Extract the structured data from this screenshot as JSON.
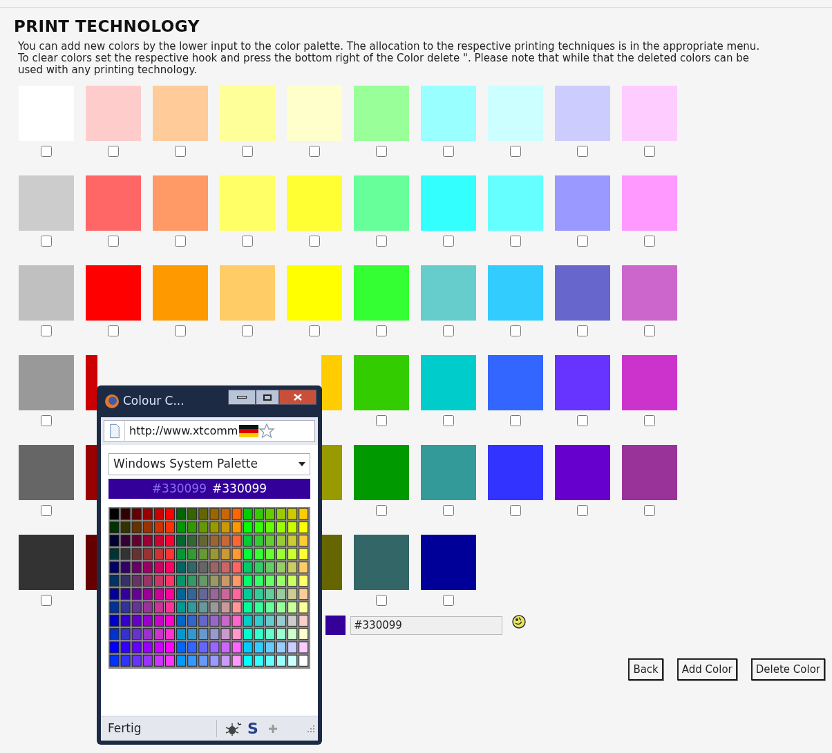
{
  "title": "PRINT TECHNOLOGY",
  "intro": [
    "You can add new colors by the lower input to the color palette. The allocation to the respective printing techniques is in the appropriate menu.",
    "To clear colors set the respective hook and press the bottom right of the Color delete \". Please note that while that the deleted colors can be used with any printing technology."
  ],
  "palette_rows": [
    [
      {
        "kind": "swatch",
        "color": "#ffffff",
        "checked": false
      },
      {
        "kind": "swatch",
        "color": "#ffcccc",
        "checked": false
      },
      {
        "kind": "swatch",
        "color": "#ffcc99",
        "checked": false
      },
      {
        "kind": "swatch",
        "color": "#ffff99",
        "checked": false
      },
      {
        "kind": "swatch",
        "color": "#ffffcc",
        "checked": false
      },
      {
        "kind": "swatch",
        "color": "#99ff99",
        "checked": false
      },
      {
        "kind": "swatch",
        "color": "#99ffff",
        "checked": false
      },
      {
        "kind": "swatch",
        "color": "#ccffff",
        "checked": false
      },
      {
        "kind": "swatch",
        "color": "#ccccff",
        "checked": false
      },
      {
        "kind": "swatch",
        "color": "#ffccff",
        "checked": false
      }
    ],
    [
      {
        "kind": "swatch",
        "color": "#cccccc",
        "checked": false
      },
      {
        "kind": "swatch",
        "color": "#ff6666",
        "checked": false
      },
      {
        "kind": "swatch",
        "color": "#ff9966",
        "checked": false
      },
      {
        "kind": "swatch",
        "color": "#ffff66",
        "checked": false
      },
      {
        "kind": "swatch",
        "color": "#ffff33",
        "checked": false
      },
      {
        "kind": "swatch",
        "color": "#66ff99",
        "checked": false
      },
      {
        "kind": "swatch",
        "color": "#33ffff",
        "checked": false
      },
      {
        "kind": "swatch",
        "color": "#66ffff",
        "checked": false
      },
      {
        "kind": "swatch",
        "color": "#9999ff",
        "checked": false
      },
      {
        "kind": "swatch",
        "color": "#ff99ff",
        "checked": false
      }
    ],
    [
      {
        "kind": "swatch",
        "color": "#c0c0c0",
        "checked": false
      },
      {
        "kind": "swatch",
        "color": "#ff0000",
        "checked": false
      },
      {
        "kind": "swatch",
        "color": "#ff9900",
        "checked": false
      },
      {
        "kind": "swatch",
        "color": "#ffcc66",
        "checked": false
      },
      {
        "kind": "swatch",
        "color": "#ffff00",
        "checked": false
      },
      {
        "kind": "swatch",
        "color": "#33ff33",
        "checked": false
      },
      {
        "kind": "swatch",
        "color": "#66cccc",
        "checked": false
      },
      {
        "kind": "swatch",
        "color": "#33ccff",
        "checked": false
      },
      {
        "kind": "swatch",
        "color": "#6666cc",
        "checked": false
      },
      {
        "kind": "swatch",
        "color": "#cc66cc",
        "checked": false
      }
    ],
    [
      {
        "kind": "swatch",
        "color": "#999999",
        "checked": false
      },
      {
        "kind": "partial",
        "color": "#cc0000"
      },
      {
        "kind": "covered"
      },
      {
        "kind": "covered"
      },
      {
        "kind": "partial",
        "color": "#ffcc00"
      },
      {
        "kind": "swatch",
        "color": "#33cc00",
        "checked": false
      },
      {
        "kind": "swatch",
        "color": "#00cccc",
        "checked": false
      },
      {
        "kind": "swatch",
        "color": "#3366ff",
        "checked": false
      },
      {
        "kind": "swatch",
        "color": "#6633ff",
        "checked": false
      },
      {
        "kind": "swatch",
        "color": "#cc33cc",
        "checked": false
      }
    ],
    [
      {
        "kind": "swatch",
        "color": "#666666",
        "checked": false
      },
      {
        "kind": "partial",
        "color": "#990000"
      },
      {
        "kind": "covered"
      },
      {
        "kind": "covered"
      },
      {
        "kind": "partial",
        "color": "#999900"
      },
      {
        "kind": "swatch",
        "color": "#009900",
        "checked": false
      },
      {
        "kind": "swatch",
        "color": "#339999",
        "checked": false
      },
      {
        "kind": "swatch",
        "color": "#3333ff",
        "checked": false
      },
      {
        "kind": "swatch",
        "color": "#6600cc",
        "checked": false
      },
      {
        "kind": "swatch",
        "color": "#993399",
        "checked": false
      }
    ],
    [
      {
        "kind": "swatch",
        "color": "#333333",
        "checked": false
      },
      {
        "kind": "partial",
        "color": "#660000"
      },
      {
        "kind": "covered"
      },
      {
        "kind": "covered"
      },
      {
        "kind": "partial",
        "color": "#666600"
      },
      {
        "kind": "swatch",
        "color": "#336666",
        "checked": false
      },
      {
        "kind": "swatch",
        "color": "#000099",
        "checked": false
      }
    ]
  ],
  "new_color": {
    "color": "#330099",
    "value": "#330099"
  },
  "buttons": [
    "Back",
    "Add Color",
    "Delete Color"
  ],
  "popup": {
    "title": "Colour C...",
    "url": "http://www.xtcomm",
    "palette_select": "Windows System Palette",
    "preview": {
      "color": "#330099",
      "ghost_text": "#330099",
      "text": "#330099"
    },
    "status": "Fertig",
    "status_icon": "S"
  }
}
